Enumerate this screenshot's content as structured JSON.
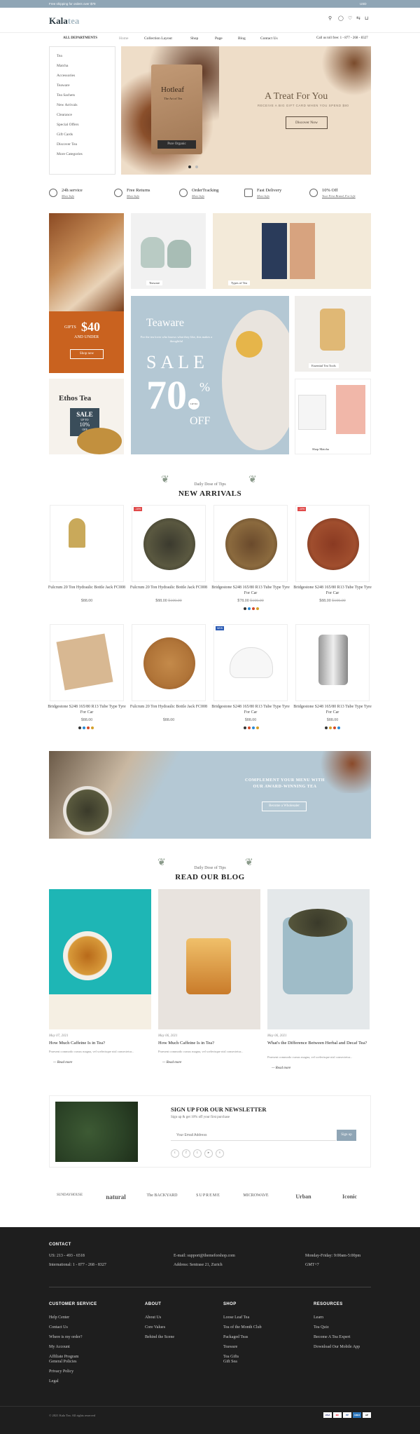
{
  "topbar": {
    "promo": "Free shipping for orders over $79",
    "currency": "USD"
  },
  "header": {
    "logo_main": "Kala",
    "logo_accent": "tea"
  },
  "nav": {
    "dept": "ALL DEPARTMENTS",
    "items": [
      "Home",
      "Collection Layout",
      "Shop",
      "Page",
      "Blog",
      "Contact Us"
    ],
    "phone": "Call us toll free: 1 - 877 - 268 - 8327"
  },
  "departments": [
    "Tea",
    "Matcha",
    "Accessories",
    "Teaware",
    "Tea Sachets",
    "New Arrivals",
    "Clearance",
    "Special Offers",
    "Gift Cards",
    "Discover Tea",
    "More Categories"
  ],
  "hero": {
    "title": "A Treat For You",
    "subtitle": "RECEIVE A BIG GIFT CARD WHEN YOU SPEND $80",
    "button": "Discover Now",
    "bag_brand": "Hotleaf",
    "bag_sub": "The Art of Tea",
    "bag_label": "Pure Organic"
  },
  "features": [
    {
      "title": "24h service",
      "sub": "More Info"
    },
    {
      "title": "Free Returns",
      "sub": "More Info"
    },
    {
      "title": "OrderTracking",
      "sub": "More Info"
    },
    {
      "title": "Fast Delivery",
      "sub": "More Info"
    },
    {
      "title": "10% Off",
      "sub": "Your First Brand, For Life"
    }
  ],
  "promo_tiles": {
    "gifts": {
      "l1": "GIFTS",
      "l2": "$40",
      "l3": "AND UNDER",
      "btn": "Shop now"
    },
    "teaware": "Teaware",
    "types": "Types of Tea",
    "sale": {
      "brand": "Teaware",
      "desc": "For the tea lover who knows what they like, this makes a thoughtful",
      "word": "SALE",
      "pct": "70",
      "unit": "%",
      "upto": "UP TO",
      "off": "OFF"
    },
    "essential": "Essential Tea Tools",
    "ethos": {
      "title": "Ethos Tea",
      "sale": "SALE",
      "upto": "UP TO",
      "pct": "10%",
      "off": "OFF"
    },
    "matcha": "Shop Matcha"
  },
  "arrivals": {
    "small": "Daily Dose of Tips",
    "title": "NEW ARRIVALS",
    "products": [
      {
        "name": "Fulcrum 20 Ton Hydraulic Bottle Jack FC008",
        "price": "$88.00",
        "old": "",
        "badge": ""
      },
      {
        "name": "Fulcrum 20 Ton Hydraulic Bottle Jack FC008",
        "price": "$88.00",
        "old": "$100.00",
        "badge": "-10%"
      },
      {
        "name": "Bridgestone S248 165/80 R13 Tube Type Tyre For Car",
        "price": "$78.00",
        "old": "$100.00",
        "badge": ""
      },
      {
        "name": "Bridgestone S248 165/80 R13 Tube Type Tyre For Car",
        "price": "$88.00",
        "old": "$100.00",
        "badge": "-10%"
      },
      {
        "name": "Bridgestone S248 165/80 R13 Tube Type Tyre For Car",
        "price": "$88.00",
        "old": "",
        "badge": ""
      },
      {
        "name": "Fulcrum 20 Ton Hydraulic Bottle Jack FC008",
        "price": "$88.00",
        "old": "",
        "badge": ""
      },
      {
        "name": "Bridgestone S248 165/80 R13 Tube Type Tyre For Car",
        "price": "$88.00",
        "old": "",
        "badge": "NEW"
      },
      {
        "name": "Bridgestone S248 165/80 R13 Tube Type Tyre For Car",
        "price": "$88.00",
        "old": "",
        "badge": ""
      }
    ]
  },
  "banner": {
    "text": "COMPLEMENT YOUR MENU WITH OUR AWARD-WINNING TEA",
    "button": "Become a Wholesaler"
  },
  "blog": {
    "small": "Daily Dose of Tips",
    "title": "READ OUR BLOG",
    "posts": [
      {
        "date": "May 07, 2021",
        "title": "How Much Caffeine Is in Tea?",
        "excerpt": "Praesent commodo cursus magna, vel scelerisque nisl consectetur...",
        "more": "Read more"
      },
      {
        "date": "May 06, 2021",
        "title": "How Much Caffeine Is in Tea?",
        "excerpt": "Praesent commodo cursus magna, vel scelerisque nisl consectetur...",
        "more": "Read more"
      },
      {
        "date": "May 06, 2021",
        "title": "What's the Difference Between Herbal and Decaf Tea?",
        "excerpt": "Praesent commodo cursus magna, vel scelerisque nisl consectetur...",
        "more": "Read more"
      }
    ]
  },
  "newsletter": {
    "title": "SIGN UP FOR OUR NEWSLETTER",
    "sub": "Sign up & get 10% off your first purchase",
    "placeholder": "Your Email Address",
    "button": "Sign up"
  },
  "brands": [
    "SUNDAYHOUSE",
    "natural",
    "The BACKYARD",
    "SUPREME",
    "MICROWAVE",
    "Urban",
    "Iconic"
  ],
  "footer": {
    "contact_h": "CONTACT",
    "us": "US: 213 - 493 - 6518",
    "intl": "International: 1 - 877 - 268 - 8327",
    "email": "E-mail: support@themeforshop.com",
    "address": "Address: Sentrase 21, Zurich",
    "hours": "Monday-Friday: 9:00am-5:00pm",
    "gmt": "GMT+7",
    "cols": [
      {
        "h": "CUSTOMER SERVICE",
        "items": [
          "Help Center",
          "Contact Us",
          "Where is my order?",
          "My Account",
          "Affiliate Program",
          "General Policies",
          "Privacy Policy",
          "Legal"
        ]
      },
      {
        "h": "ABOUT",
        "items": [
          "About Us",
          "Core Values",
          "Behind the Scene"
        ]
      },
      {
        "h": "SHOP",
        "items": [
          "Loose Leaf Tea",
          "Tea of the Month Club",
          "Packaged Teas",
          "Teaware",
          "Tea Gifts",
          "Gift Sea"
        ]
      },
      {
        "h": "RESOURCES",
        "items": [
          "Learn",
          "Tea Quiz",
          "Become A Tea Expert",
          "Download Our Mobile App"
        ]
      }
    ],
    "copyright": "© 2021 Kala Tea. All rights reserved",
    "payments": [
      "VISA",
      "MC",
      "PP",
      "AMEX",
      "AP"
    ]
  },
  "colors": {
    "accent": "#8fa5b5",
    "orange": "#c9621f",
    "dark": "#1e1e1e"
  }
}
